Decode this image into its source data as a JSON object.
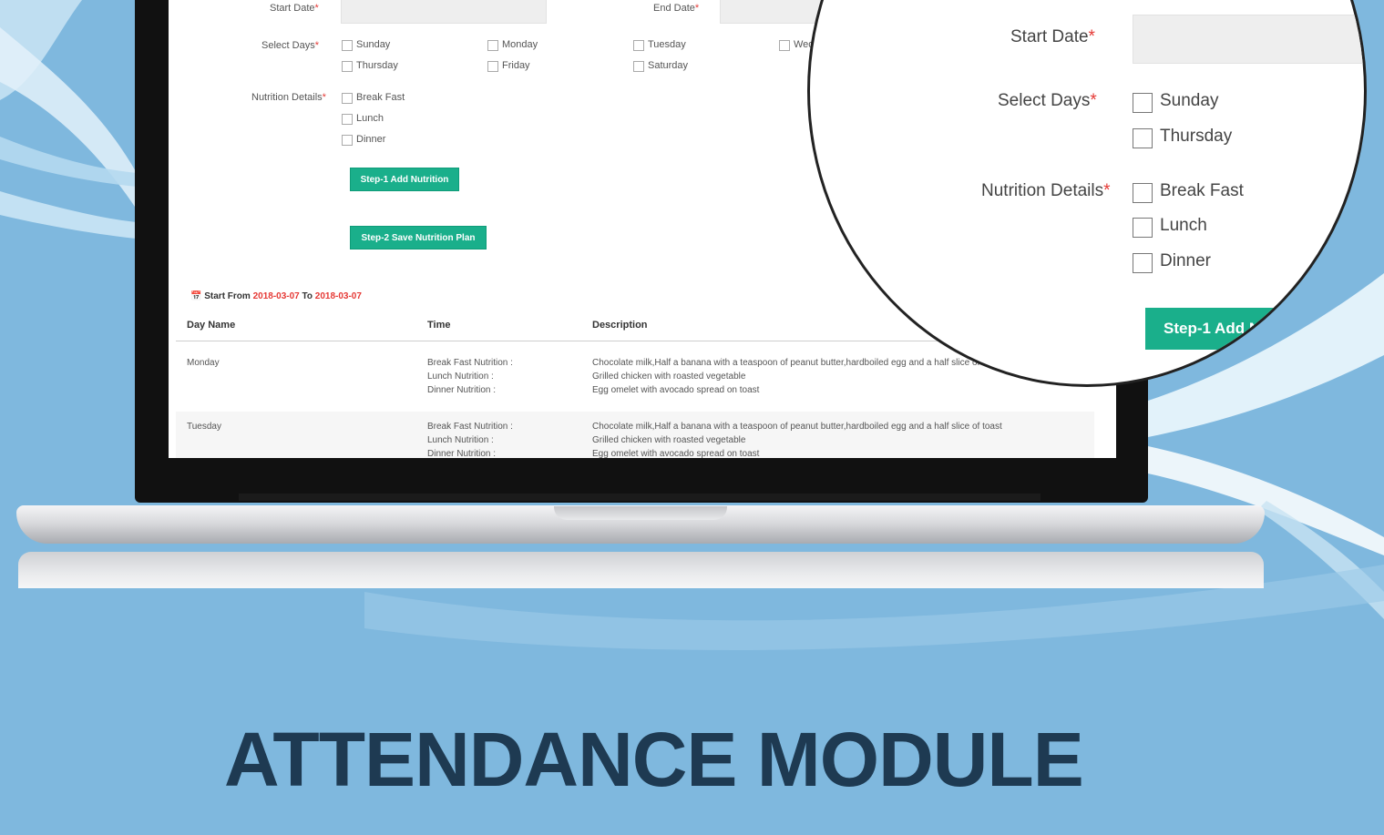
{
  "colors": {
    "background": "#7fb8de",
    "accent": "#1aaf8b",
    "required": "#e53935",
    "title": "#1e3a52"
  },
  "form": {
    "start_date_label": "Start Date",
    "end_date_label": "End Date",
    "required_mark": "*",
    "select_days_label": "Select Days",
    "days": [
      "Sunday",
      "Monday",
      "Tuesday",
      "Wednesday",
      "Thursday",
      "Friday",
      "Saturday"
    ],
    "nutrition_details_label": "Nutrition Details",
    "meals": [
      "Break Fast",
      "Lunch",
      "Dinner"
    ],
    "step1_button": "Step-1 Add Nutrition",
    "step2_button": "Step-2 Save Nutrition Plan"
  },
  "plan": {
    "range_prefix": "Start From",
    "start": "2018-03-07",
    "range_mid": "To",
    "end": "2018-03-07",
    "icon": "calendar-icon",
    "columns": [
      "Day Name",
      "Time",
      "Description"
    ],
    "rows": [
      {
        "day": "Monday",
        "times": [
          "Break Fast Nutrition :",
          "Lunch Nutrition :",
          "Dinner Nutrition :"
        ],
        "descriptions": [
          "Chocolate milk,Half a banana with a teaspoon of peanut butter,hardboiled egg and a half slice of toast",
          "Grilled chicken with roasted vegetable",
          "Egg omelet with avocado spread on toast"
        ]
      },
      {
        "day": "Tuesday",
        "times": [
          "Break Fast Nutrition :",
          "Lunch Nutrition :",
          "Dinner Nutrition :"
        ],
        "descriptions": [
          "Chocolate milk,Half a banana with a teaspoon of peanut butter,hardboiled egg and a half slice of toast",
          "Grilled chicken with roasted vegetable",
          "Egg omelet with avocado spread on toast"
        ]
      }
    ]
  },
  "magnifier": {
    "start_date_label": "Start Date",
    "select_days_label": "Select Days",
    "days": [
      "Sunday",
      "Thursday"
    ],
    "nutrition_details_label": "Nutrition Details",
    "meals": [
      "Break Fast",
      "Lunch",
      "Dinner"
    ],
    "button": "Step-1 Add N"
  },
  "heading": "ATTENDANCE MODULE"
}
